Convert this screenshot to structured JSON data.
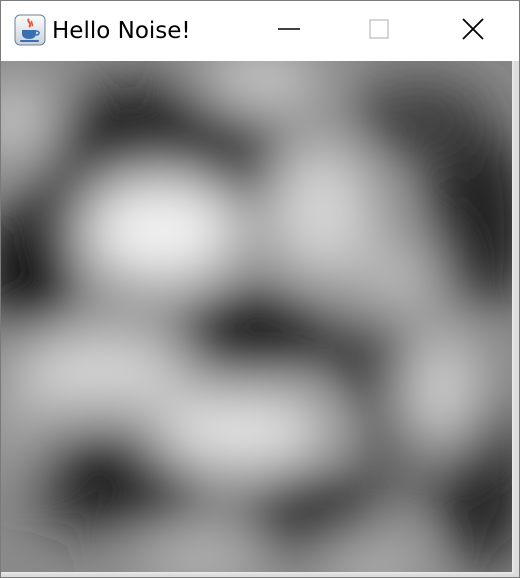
{
  "window": {
    "title": "Hello Noise!",
    "icon": "java-coffee-cup-icon",
    "controls": {
      "minimize_icon": "minimize-icon",
      "maximize_icon": "maximize-icon",
      "close_icon": "close-icon"
    }
  },
  "canvas": {
    "content": "grayscale-noise-image"
  },
  "colors": {
    "titlebar_bg": "#ffffff",
    "title_text": "#000000",
    "noise_dark": "#1a1a1a",
    "noise_light": "#f0f0f0",
    "accent_java_red": "#e4572e",
    "accent_java_blue": "#3a6fb0"
  }
}
